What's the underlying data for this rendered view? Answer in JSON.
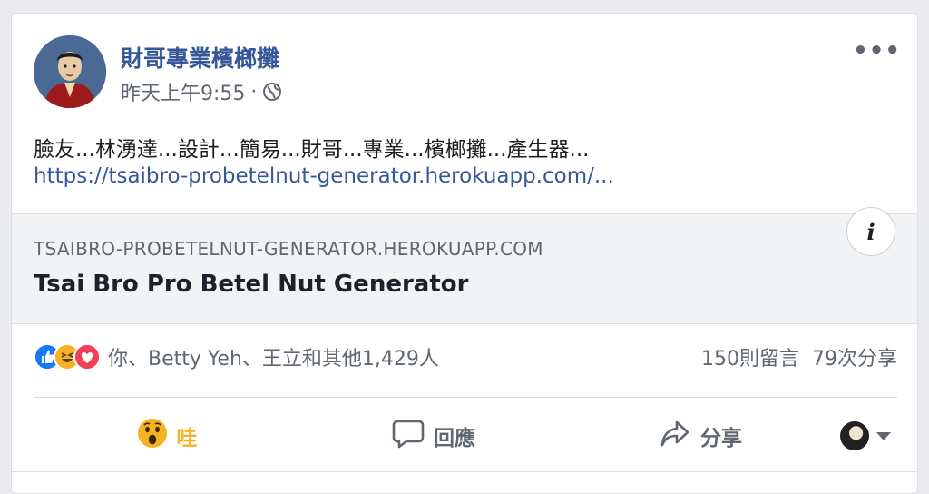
{
  "post": {
    "author": "財哥專業檳榔攤",
    "timestamp": "昨天上午9:55",
    "separator": "·",
    "privacy_icon": "globe-icon",
    "text": "臉友...林湧達...設計...簡易...財哥...專業...檳榔攤...產生器...",
    "link": "https://tsaibro-probetelnut-generator.herokuapp.com/...",
    "more_label": "•••"
  },
  "preview": {
    "domain": "TSAIBRO-PROBETELNUT-GENERATOR.HEROKUAPP.COM",
    "title": "Tsai Bro Pro Betel Nut Generator",
    "info_label": "i"
  },
  "reactions": {
    "icons": [
      "like-icon",
      "haha-icon",
      "love-icon"
    ],
    "summary": "你、Betty Yeh、王立和其他1,429人",
    "comments": "150則留言",
    "shares": "79次分享"
  },
  "actions": {
    "reaction_label": "哇",
    "comment_label": "回應",
    "share_label": "分享"
  },
  "colors": {
    "link": "#365899",
    "muted": "#606770",
    "like": "#1877f2",
    "love": "#f33e58",
    "haha": "#f7b125"
  }
}
